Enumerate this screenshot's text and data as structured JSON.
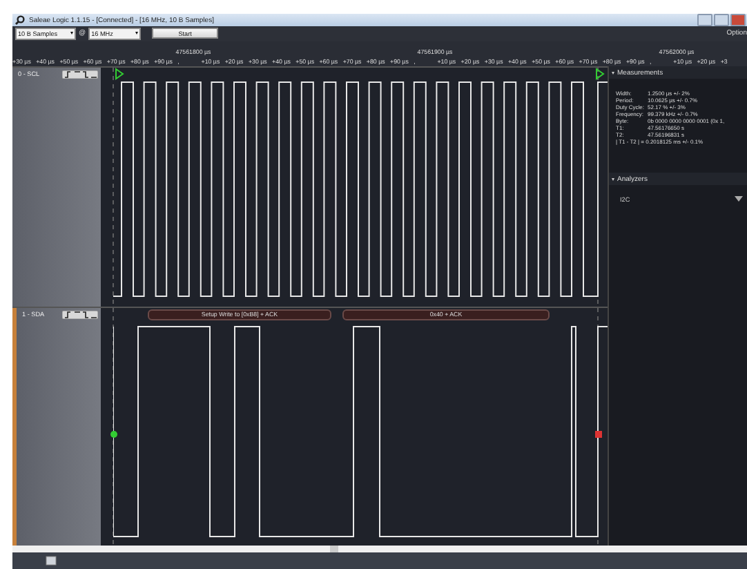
{
  "window": {
    "title": "Saleae Logic 1.1.15 - [Connected] - [16 MHz, 10 B Samples]"
  },
  "toolbar": {
    "samples": "10 B Samples",
    "at": "@",
    "rate": "16 MHz",
    "start_button": "Start",
    "options": "Option"
  },
  "ruler": {
    "times": [
      "47561800 µs",
      "47561900 µs",
      "47562000 µs"
    ],
    "ticks": [
      "+30 µs",
      "+40 µs",
      "+50 µs",
      "+60 µs",
      "+70 µs",
      "+80 µs",
      "+90 µs",
      ",",
      "+10 µs",
      "+20 µs",
      "+30 µs",
      "+40 µs",
      "+50 µs",
      "+60 µs",
      "+70 µs",
      "+80 µs",
      "+90 µs",
      ",",
      "+10 µs",
      "+20 µs",
      "+30 µs",
      "+40 µs",
      "+50 µs",
      "+60 µs",
      "+70 µs",
      "+80 µs",
      "+90 µs",
      ",",
      "+10 µs",
      "+20 µs",
      "+3"
    ]
  },
  "channels": [
    {
      "label": "0 - SCL",
      "kind": "clock"
    },
    {
      "label": "1 - SDA",
      "kind": "data",
      "decoded": [
        "Setup Write to [0xB8] + ACK",
        "0x40 + ACK"
      ]
    }
  ],
  "measurements": {
    "title": "Measurements",
    "expanded": true,
    "rows": [
      {
        "label": "Width:",
        "value": "1.2500 µs +/- 2%"
      },
      {
        "label": "Period:",
        "value": "10.0625 µs +/- 0.7%"
      },
      {
        "label": "Duty Cycle:",
        "value": "52.17 % +/- 3%"
      },
      {
        "label": "Frequency:",
        "value": "99.379 kHz +/- 0.7%"
      },
      {
        "label": "Byte:",
        "value": "0b 0000 0000 0000 0001 (0x 1,"
      },
      {
        "label": "T1:",
        "value": "47.56176650 s"
      },
      {
        "label": "T2:",
        "value": "47.56196831 s"
      }
    ],
    "difference": "| T1 - T2 | = 0.2018125 ms +/- 0.1%"
  },
  "analyzers": {
    "title": "Analyzers",
    "expanded": true,
    "items": [
      "I2C"
    ]
  }
}
